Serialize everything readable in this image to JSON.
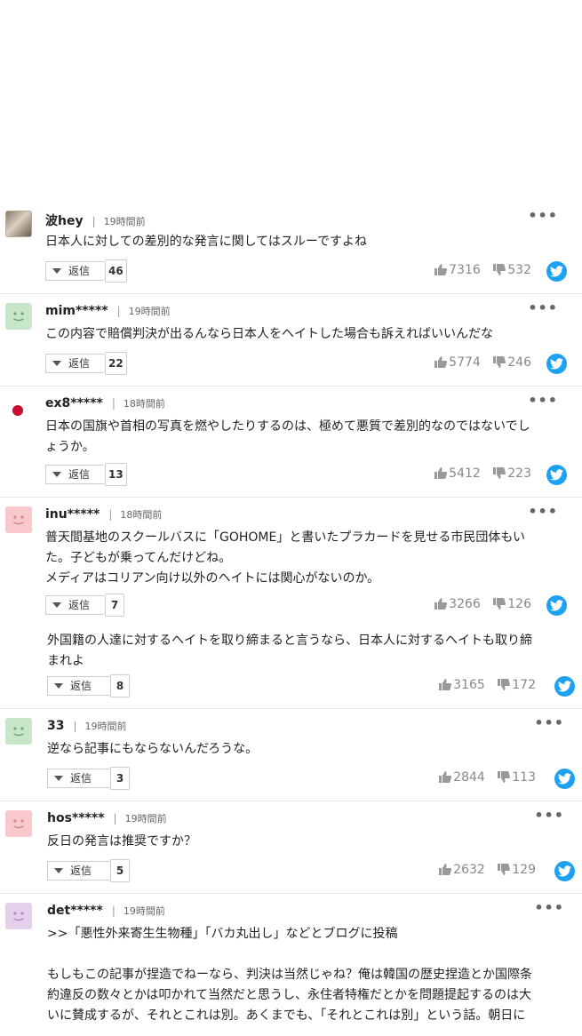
{
  "comments": [
    {
      "name": "波hey",
      "time": "19時間前",
      "text": "日本人に対しての差別的な発言に関してはスルーですよね",
      "reply_label": "返信",
      "reply_count": "46",
      "likes": "7316",
      "dislikes": "532",
      "more": "•••"
    },
    {
      "name": "mim*****",
      "time": "19時間前",
      "text": "この内容で賠償判決が出るんなら日本人をヘイトした場合も訴えればいいんだな",
      "reply_label": "返信",
      "reply_count": "22",
      "likes": "5774",
      "dislikes": "246",
      "more": "•••"
    },
    {
      "name": "ex8*****",
      "time": "18時間前",
      "text": "日本の国旗や首相の写真を燃やしたりするのは、極めて悪質で差別的なのではないでし\nょうか。",
      "reply_label": "返信",
      "reply_count": "13",
      "likes": "5412",
      "dislikes": "223",
      "more": "•••"
    },
    {
      "name": "inu*****",
      "time": "18時間前",
      "text": "普天間基地のスクールバスに「GOHOME」と書いたプラカードを見せる市民団体もい\nた。子どもが乗ってんだけどね。\nメディアはコリアン向け以外のヘイトには関心がないのか。",
      "reply_label": "返信",
      "reply_count": "7",
      "likes": "3266",
      "dislikes": "126",
      "more": "•••"
    },
    {
      "name": "",
      "time": "",
      "text": "外国籍の人達に対するヘイトを取り締まると言うなら、日本人に対するヘイトも取り締\nまれよ",
      "reply_label": "返信",
      "reply_count": "8",
      "likes": "3165",
      "dislikes": "172"
    },
    {
      "name": "33",
      "time": "19時間前",
      "text": "逆なら記事にもならないんだろうな。",
      "reply_label": "返信",
      "reply_count": "3",
      "likes": "2844",
      "dislikes": "113",
      "more": "•••"
    },
    {
      "name": "hos*****",
      "time": "19時間前",
      "text": "反日の発言は推奨ですか？",
      "reply_label": "返信",
      "reply_count": "5",
      "likes": "2632",
      "dislikes": "129",
      "more": "•••"
    },
    {
      "name": "det*****",
      "time": "19時間前",
      "text": ">>「悪性外来寄生生物種」「バカ丸出し」などとブログに投稿\n\nもしもこの記事が捏造でねーなら、判決は当然じゃね？俺は韓国の歴史捏造とか国際条\n約違反の数々とかは叩かれて当然だと思うし、永住者特権だとかを問題提起するのは大\nいに賛成するが、それとこれは別。あくまでも、「それとこれは別」という話。朝日に",
      "more": "•••"
    }
  ],
  "colors": {
    "twitter": "#1da1f2",
    "avatar_green": "#c8e6c9",
    "avatar_pink": "#f8c8cc",
    "avatar_purple": "#e5d0ec",
    "flag_red": "#c8102e"
  }
}
